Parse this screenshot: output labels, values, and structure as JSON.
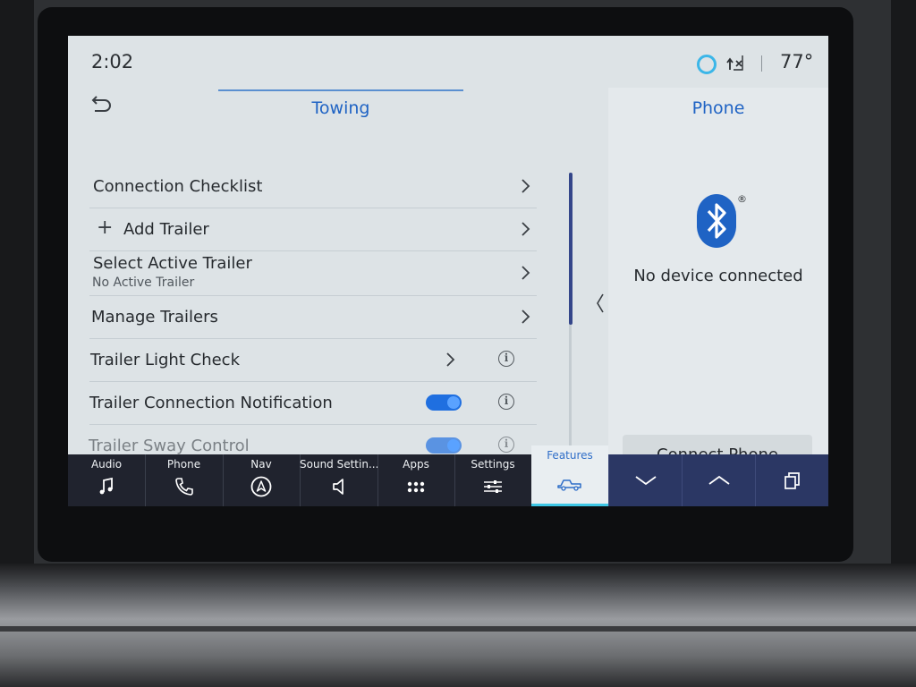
{
  "status": {
    "time": "2:02",
    "temperature": "77°"
  },
  "towing": {
    "title": "Towing",
    "rows": [
      {
        "label": "Connection Checklist"
      },
      {
        "label": "Add Trailer"
      },
      {
        "label": "Select Active Trailer",
        "sublabel": "No Active Trailer"
      },
      {
        "label": "Manage Trailers"
      },
      {
        "label": "Trailer Light Check"
      },
      {
        "label": "Trailer Connection Notification",
        "toggle": true
      },
      {
        "label": "Trailer Sway Control",
        "toggle": true
      }
    ]
  },
  "phone": {
    "title": "Phone",
    "registered_mark": "®",
    "status": "No device connected",
    "connect_label": "Connect Phone"
  },
  "dock": {
    "items": [
      {
        "label": "Audio",
        "icon": "music-note-icon"
      },
      {
        "label": "Phone",
        "icon": "phone-icon"
      },
      {
        "label": "Nav",
        "icon": "navigation-icon"
      },
      {
        "label": "Sound Settin...",
        "icon": "speaker-icon"
      },
      {
        "label": "Apps",
        "icon": "apps-grid-icon"
      },
      {
        "label": "Settings",
        "icon": "settings-sliders-icon"
      },
      {
        "label": "Features",
        "icon": "truck-icon",
        "active": true
      }
    ]
  },
  "colors": {
    "accent": "#1f63c4",
    "toggle_on": "#1f6fe0",
    "dock_bg": "#20232e",
    "features_bar": "#3ec7e6"
  }
}
